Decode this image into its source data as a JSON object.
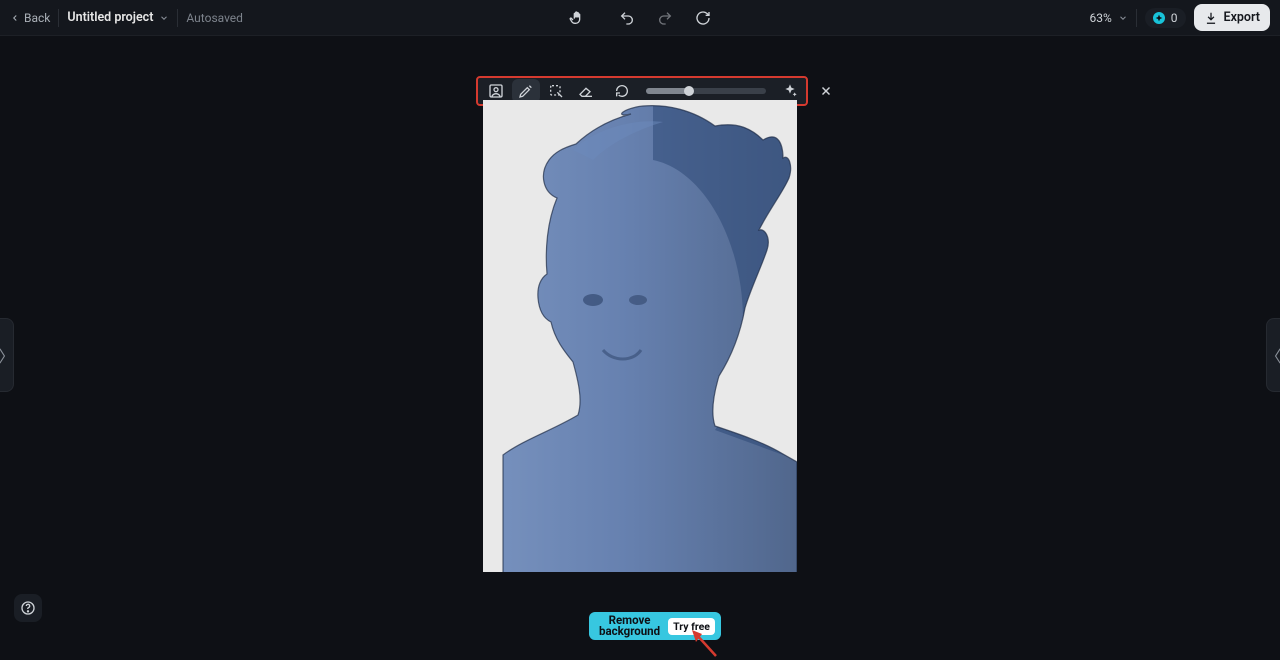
{
  "header": {
    "back_label": "Back",
    "project_name": "Untitled project",
    "autosaved_label": "Autosaved",
    "zoom_label": "63%",
    "tokens": "0",
    "export_label": "Export"
  },
  "toolbar": {
    "icons": {
      "person": "person-mask-icon",
      "brush": "brush-icon",
      "lasso": "lasso-select-icon",
      "eraser": "eraser-icon",
      "restore_brush": "restore-brush-icon",
      "close": "close-icon"
    },
    "slider_value_percent": 36
  },
  "cta": {
    "line1": "Remove",
    "line2": "background",
    "try_label": "Try free"
  },
  "rails": {
    "left_glyph": "〉",
    "right_glyph": "〈"
  },
  "help_glyph": "?",
  "colors": {
    "accent_cyan": "#37c7e0",
    "annotation_red": "#d53a2f",
    "mask_blue": "#4a6aa3",
    "mask_blue_dark": "#2f4a78"
  }
}
